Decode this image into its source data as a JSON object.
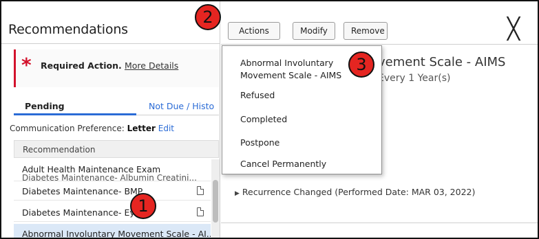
{
  "left_panel": {
    "title": "Recommendations",
    "required": {
      "star": "*",
      "text": "Required Action.",
      "link": "More Details"
    },
    "tabs": {
      "pending": "Pending",
      "not_due": "Not Due / Histo"
    },
    "communication": {
      "label": "Communication Preference:",
      "value": "Letter",
      "edit": "Edit"
    },
    "column_header": "Recommendation",
    "rows": [
      {
        "label": "Adult Health Maintenance Exam",
        "sub": "Diabetes Maintenance- Albumin Creatini..."
      },
      {
        "label": "Diabetes Maintenance- BMP"
      },
      {
        "label": "Diabetes Maintenance- Ey"
      },
      {
        "label": "Abnormal Involuntary Movement Scale - AI..."
      }
    ]
  },
  "toolbar": {
    "actions_label": "Actions",
    "actions_chevron": "∨",
    "modify_label": "Modify",
    "remove_label": "Remove",
    "close_glyph": "╳"
  },
  "detail": {
    "title": "vement Scale - AIMS",
    "subtitle": "Every 1 Year(s)",
    "recurrence": "Recurrence Changed (Performed Date: MAR 03, 2022)",
    "recurrence_marker": "▶"
  },
  "actions_menu": {
    "items": [
      "Abnormal Involuntary",
      "Movement Scale - AIMS",
      "Refused",
      "Completed",
      "Postpone",
      "Cancel Permanently"
    ]
  },
  "callouts": {
    "one": "1",
    "two": "2",
    "three": "3"
  },
  "colors": {
    "required_red": "#d3122c",
    "link_blue": "#2a6bd6",
    "selected_row": "#dbe8f7",
    "callout_red": "#e52521"
  },
  "icons": {
    "row_document": "document-icon",
    "close": "close-icon",
    "dropdown": "chevron-down-icon",
    "expand": "triangle-right-icon"
  }
}
